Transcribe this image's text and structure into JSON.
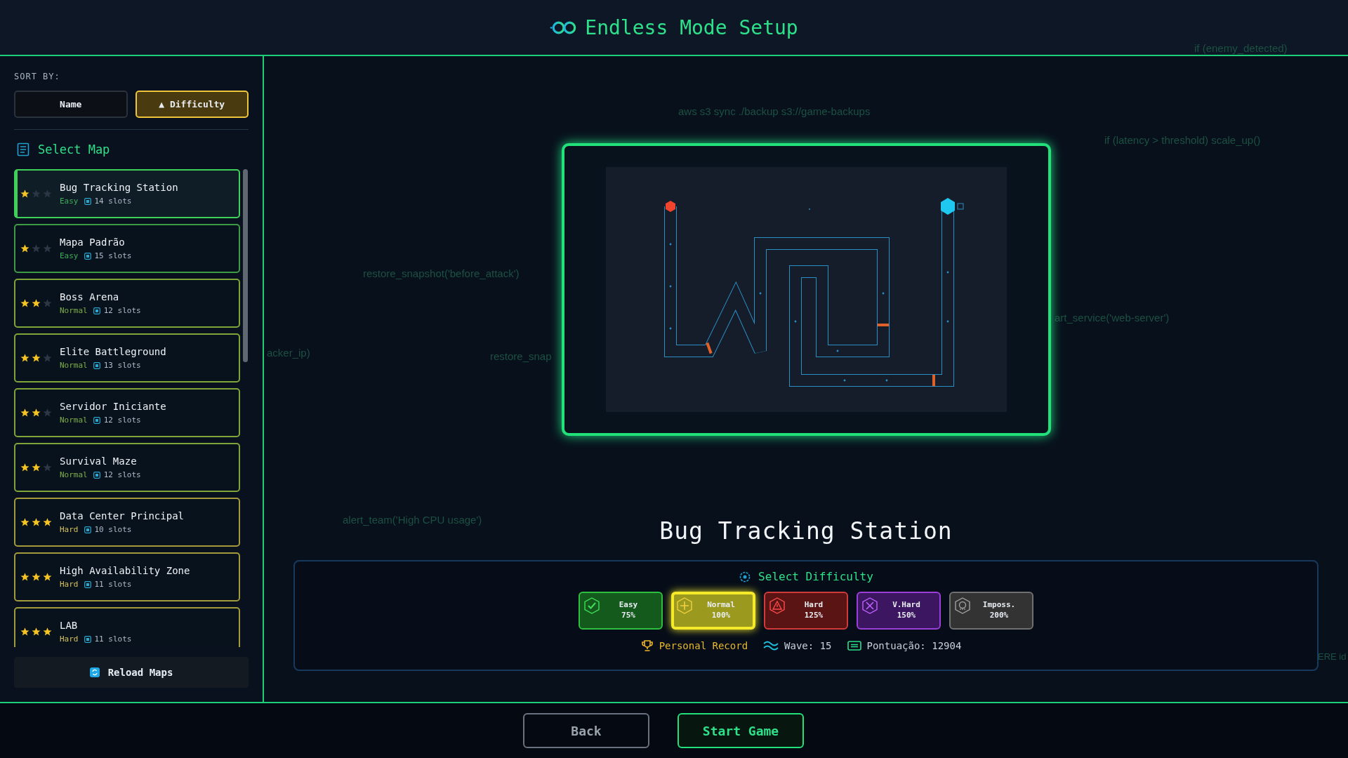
{
  "header": {
    "title": "Endless Mode Setup"
  },
  "sidebar": {
    "sort_label": "SORT BY:",
    "sort_buttons": [
      {
        "label": "Name",
        "selected": false
      },
      {
        "label": "▲ Difficulty",
        "selected": true
      }
    ],
    "list_title": "Select Map",
    "maps": [
      {
        "name": "Bug Tracking Station",
        "difficulty": "Easy",
        "kind": "easy",
        "stars": 1,
        "slots": "14 slots",
        "selected": true
      },
      {
        "name": "Mapa Padrão",
        "difficulty": "Easy",
        "kind": "easy",
        "stars": 1,
        "slots": "15 slots",
        "selected": false
      },
      {
        "name": "Boss Arena",
        "difficulty": "Normal",
        "kind": "normal",
        "stars": 2,
        "slots": "12 slots",
        "selected": false
      },
      {
        "name": "Elite Battleground",
        "difficulty": "Normal",
        "kind": "normal",
        "stars": 2,
        "slots": "13 slots",
        "selected": false
      },
      {
        "name": "Servidor Iniciante",
        "difficulty": "Normal",
        "kind": "normal",
        "stars": 2,
        "slots": "12 slots",
        "selected": false
      },
      {
        "name": "Survival Maze",
        "difficulty": "Normal",
        "kind": "normal",
        "stars": 2,
        "slots": "12 slots",
        "selected": false
      },
      {
        "name": "Data Center Principal",
        "difficulty": "Hard",
        "kind": "hard",
        "stars": 3,
        "slots": "10 slots",
        "selected": false
      },
      {
        "name": "High Availability Zone",
        "difficulty": "Hard",
        "kind": "hard",
        "stars": 3,
        "slots": "11 slots",
        "selected": false
      },
      {
        "name": "LAB",
        "difficulty": "Hard",
        "kind": "hard",
        "stars": 3,
        "slots": "11 slots",
        "selected": false
      }
    ],
    "reload_button": "Reload Maps"
  },
  "background_code": [
    "if (enemy_detected)",
    "aws s3 sync ./backup s3://game-backups",
    "if (latency > threshold) scale_up()",
    "restore_snapshot('before_attack')",
    "acker_ip)",
    "restore_snap",
    "art_service('web-server')",
    "alert_team('High CPU usage')",
    "ERE id"
  ],
  "map_title": "Bug Tracking Station",
  "difficulty_panel": {
    "title": "Select Difficulty",
    "options": [
      {
        "kind": "easy",
        "label": "Easy",
        "multiplier": "75%",
        "selected": false
      },
      {
        "kind": "normal",
        "label": "Normal",
        "multiplier": "100%",
        "selected": true
      },
      {
        "kind": "hard",
        "label": "Hard",
        "multiplier": "125%",
        "selected": false
      },
      {
        "kind": "vhard",
        "label": "V.Hard",
        "multiplier": "150%",
        "selected": false
      },
      {
        "kind": "impossible",
        "label": "Imposs.",
        "multiplier": "200%",
        "selected": false
      }
    ],
    "record": {
      "label": "Personal Record",
      "wave": "Wave: 15",
      "score": "Pontuação: 12904"
    }
  },
  "footer": {
    "back_button": "Back",
    "start_button": "Start Game"
  }
}
